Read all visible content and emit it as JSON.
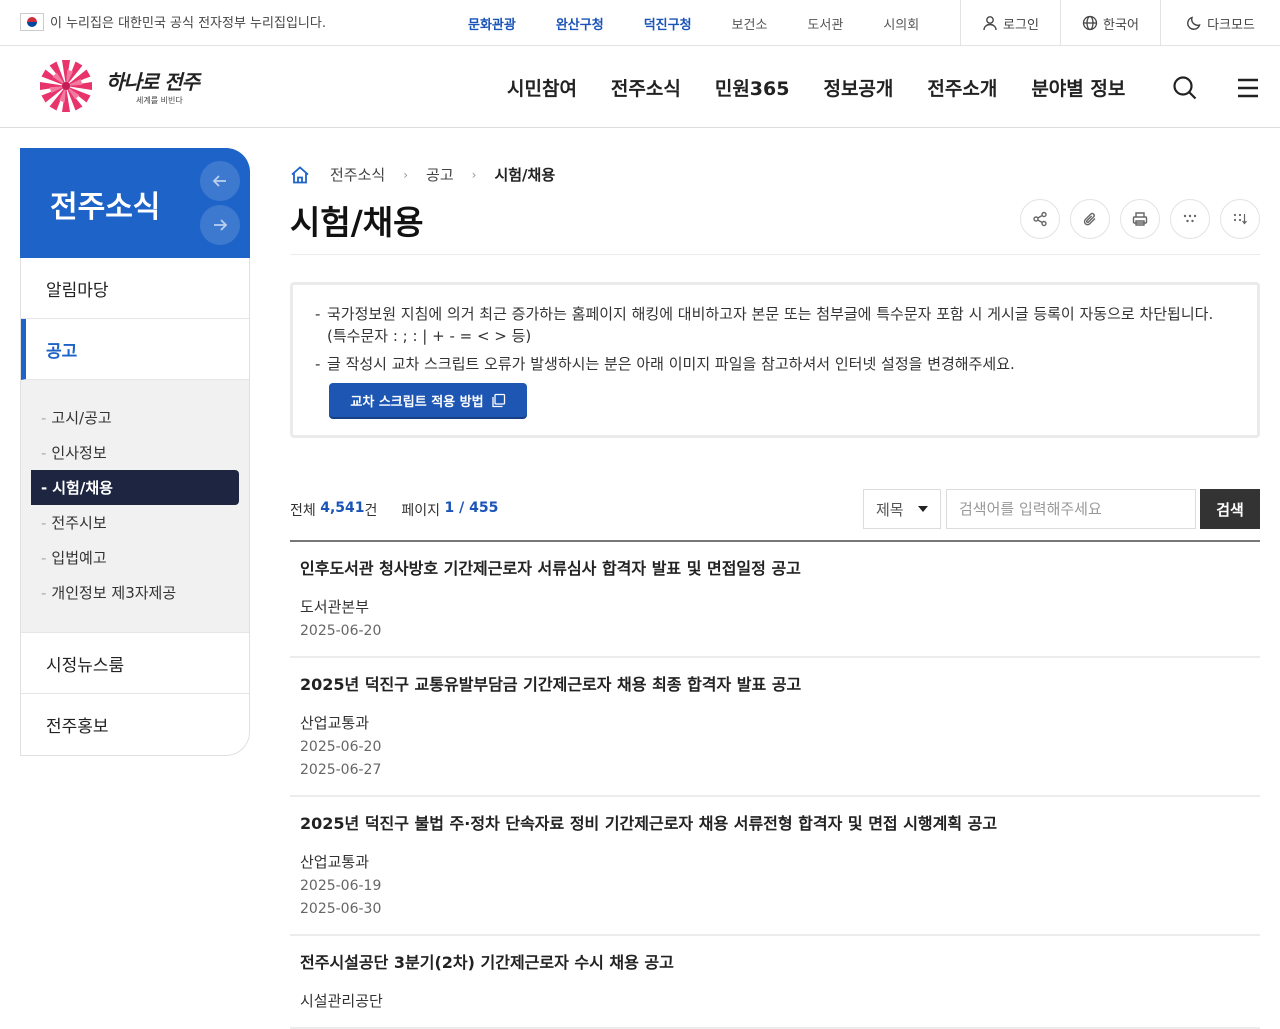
{
  "util": {
    "gov_notice": "이 누리집은 대한민국 공식 전자정부 누리집입니다.",
    "sites": [
      {
        "label": "문화관광",
        "highlight": true
      },
      {
        "label": "완산구청",
        "highlight": true
      },
      {
        "label": "덕진구청",
        "highlight": true
      },
      {
        "label": "보건소",
        "highlight": false
      },
      {
        "label": "도서관",
        "highlight": false
      },
      {
        "label": "시의회",
        "highlight": false
      }
    ],
    "login": "로그인",
    "language": "한국어",
    "darkmode": "다크모드"
  },
  "header": {
    "logo_main": "하나로 전주",
    "logo_sub": "세계를 비빈다",
    "nav": [
      "시민참여",
      "전주소식",
      "민원365",
      "정보공개",
      "전주소개",
      "분야별 정보"
    ]
  },
  "sidebar": {
    "title": "전주소식",
    "items": [
      {
        "label": "알림마당",
        "active": false
      },
      {
        "label": "공고",
        "active": true
      },
      {
        "label": "시정뉴스룸",
        "active": false
      },
      {
        "label": "전주홍보",
        "active": false
      }
    ],
    "subitems": [
      {
        "label": "고시/공고",
        "active": false
      },
      {
        "label": "인사정보",
        "active": false
      },
      {
        "label": "시험/채용",
        "active": true
      },
      {
        "label": "전주시보",
        "active": false
      },
      {
        "label": "입법예고",
        "active": false
      },
      {
        "label": "개인정보 제3자제공",
        "active": false
      }
    ]
  },
  "breadcrumb": [
    "전주소식",
    "공고",
    "시험/채용"
  ],
  "page_title": "시험/채용",
  "notice": {
    "items": [
      "국가정보원 지침에 의거 최근 증가하는 홈페이지 해킹에 대비하고자 본문 또는 첨부글에 특수문자 포함 시 게시글 등록이 자동으로 차단됩니다. (특수문자 : ; : | + - = < > 등)",
      "글 작성시 교차 스크립트 오류가 발생하시는 분은 아래 이미지 파일을 참고하셔서 인터넷 설정을 변경해주세요."
    ],
    "button": "교차 스크립트 적용 방법"
  },
  "board": {
    "total_label": "전체",
    "total": "4,541",
    "total_unit": "건",
    "page_label": "페이지",
    "page_current": "1",
    "page_sep": " / ",
    "page_total": "455",
    "search_option": "제목",
    "search_placeholder": "검색어를 입력해주세요",
    "search_button": "검색",
    "rows": [
      {
        "title": "인후도서관 청사방호 기간제근로자 서류심사 합격자 발표 및 면접일정 공고",
        "dept": "도서관본부",
        "dates": [
          "2025-06-20"
        ]
      },
      {
        "title": "2025년 덕진구 교통유발부담금 기간제근로자 채용 최종 합격자 발표 공고",
        "dept": "산업교통과",
        "dates": [
          "2025-06-20",
          "2025-06-27"
        ]
      },
      {
        "title": "2025년 덕진구 불법 주·정차 단속자료 정비 기간제근로자 채용 서류전형 합격자 및 면접 시행계획 공고",
        "dept": "산업교통과",
        "dates": [
          "2025-06-19",
          "2025-06-30"
        ]
      },
      {
        "title": "전주시설공단 3분기(2차) 기간제근로자 수시 채용 공고",
        "dept": "시설관리공단",
        "dates": []
      }
    ]
  }
}
